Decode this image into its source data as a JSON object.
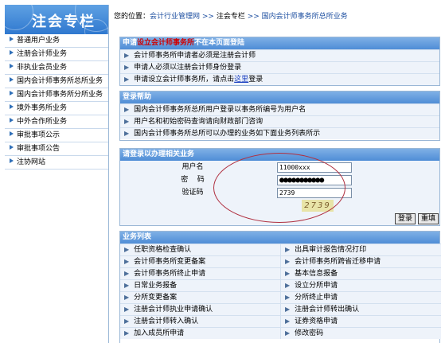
{
  "sidebar": {
    "title": "注会专栏",
    "items": [
      {
        "label": "普通用户业务"
      },
      {
        "label": "注册会计师业务"
      },
      {
        "label": "非执业会员业务"
      },
      {
        "label": "国内会计师事务所总所业务"
      },
      {
        "label": "国内会计师事务所分所业务"
      },
      {
        "label": "境外事务所业务"
      },
      {
        "label": "中外合作所业务"
      },
      {
        "label": "审批事项公示"
      },
      {
        "label": "审批事项公告"
      },
      {
        "label": "注协网站"
      }
    ]
  },
  "breadcrumb": {
    "prefix": "您的位置：",
    "item1": "会计行业管理网",
    "sep1": " >> ",
    "item2": "注会专栏",
    "sep2": " >> ",
    "item3": "国内会计师事务所总所业务"
  },
  "apply_panel": {
    "title_pre": "申请",
    "title_red": "设立会计师事务所",
    "title_post": "不在本页面登陆",
    "rows": [
      "会计师事务所申请者必须是注册会计师",
      "申请人必须以注册会计师身份登录"
    ],
    "row3_pre": "申请设立会计师事务所，请点击",
    "row3_link": "这里",
    "row3_post": "登录"
  },
  "help_panel": {
    "title": "登录帮助",
    "rows": [
      "国内会计师事务所总所用户登录以事务所编号为用户名",
      "用户名和初始密码查询请向财政部门咨询",
      "国内会计师事务所总所可以办理的业务如下面业务列表所示"
    ]
  },
  "login_panel": {
    "title": "请登录以办理相关业务",
    "username_label": "用户名",
    "username_value": "11000xxx",
    "password_label": "密    码",
    "password_value": "●●●●●●●●●●●",
    "captcha_label": "验证码",
    "captcha_value": "2739",
    "captcha_image_text": "2739",
    "login_button": "登录",
    "reset_button": "重填"
  },
  "biz_panel": {
    "title": "业务列表",
    "items": [
      "任职资格检查确认",
      "出具审计报告情况打印",
      "会计师事务所变更备案",
      "会计师事务所跨省迁移申请",
      "会计师事务所终止申请",
      "基本信息报备",
      "日常业务报备",
      "设立分所申请",
      "分所变更备案",
      "分所终止申请",
      "注册会计师执业申请确认",
      "注册会计师转出确认",
      "注册会计师转入确认",
      "证券资格申请",
      "加入成员所申请",
      "修改密码"
    ]
  },
  "colors": {
    "header_blue": "#4f8dd6",
    "link_blue": "#1e4fa0",
    "highlight_red": "#d00000",
    "annotation_oval": "#b03040"
  }
}
